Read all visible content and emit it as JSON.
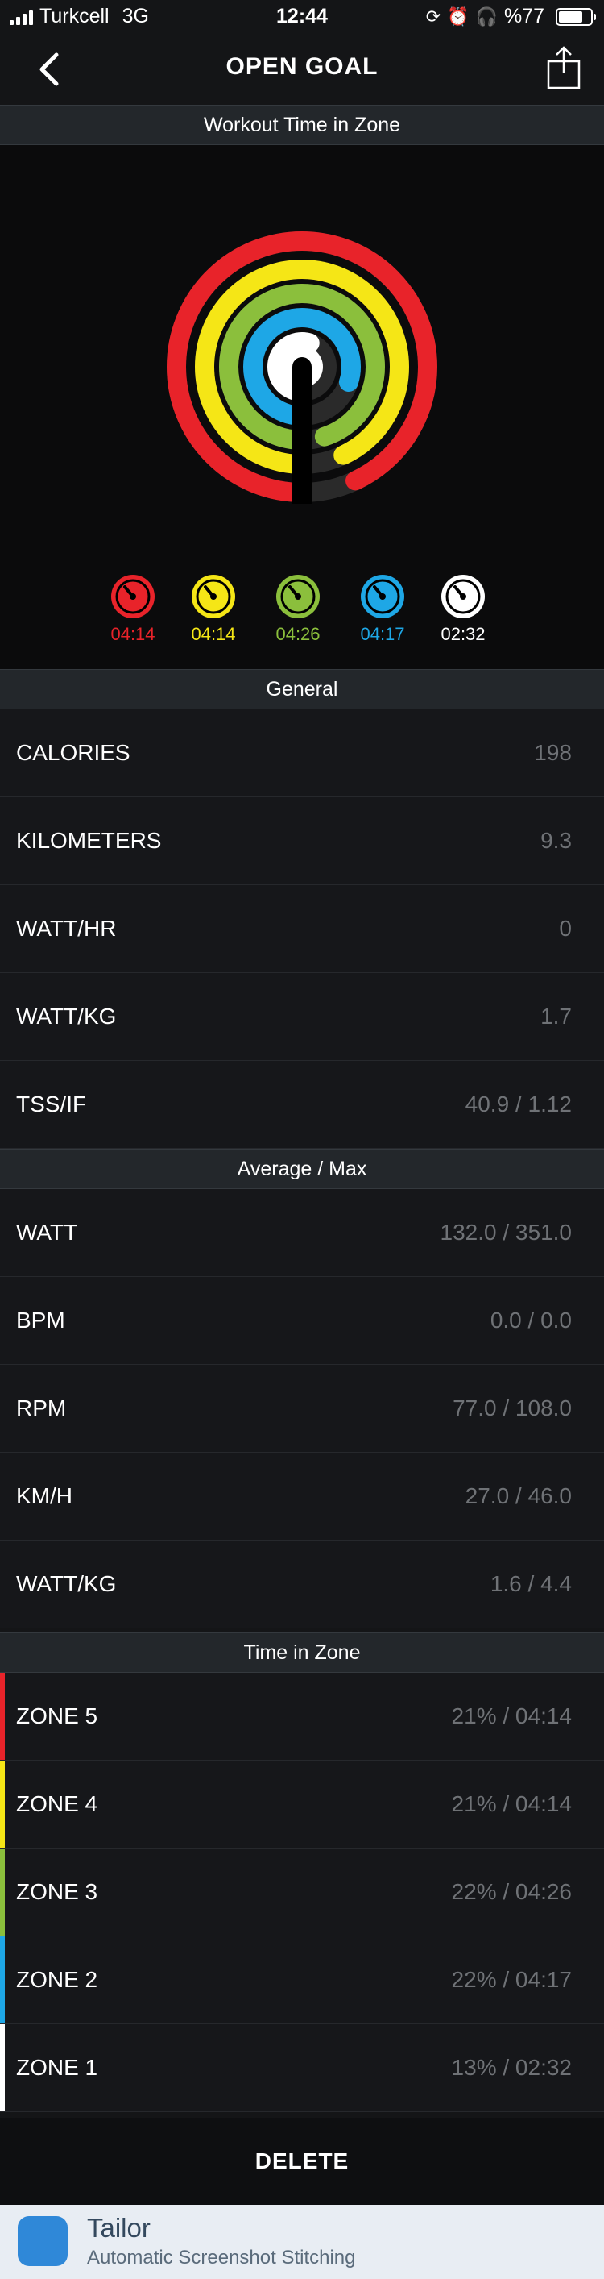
{
  "status_bar": {
    "carrier": "Turkcell",
    "network": "3G",
    "time": "12:44",
    "battery": "%77",
    "battery_level": 0.77,
    "icons": [
      "signal-bars-icon",
      "rotation-lock-icon",
      "alarm-icon",
      "headphones-icon",
      "battery-icon"
    ]
  },
  "nav": {
    "title": "OPEN GOAL",
    "back_icon": "chevron-left-icon",
    "share_icon": "share-icon"
  },
  "workout_section": {
    "header": "Workout Time in Zone"
  },
  "zone_chart": {
    "rings": [
      {
        "zone": "ZONE 5",
        "color": "#e8232a",
        "fraction": 0.93
      },
      {
        "zone": "ZONE 4",
        "color": "#f5e616",
        "fraction": 0.93
      },
      {
        "zone": "ZONE 3",
        "color": "#8bbf3c",
        "fraction": 0.95
      },
      {
        "zone": "ZONE 2",
        "color": "#1ea7e6",
        "fraction": 0.8
      },
      {
        "zone": "ZONE 1",
        "color": "#ffffff",
        "fraction": 0.55
      }
    ],
    "legend": [
      {
        "label": "04:14",
        "color": "#e8232a"
      },
      {
        "label": "04:14",
        "color": "#f5e616"
      },
      {
        "label": "04:26",
        "color": "#8bbf3c"
      },
      {
        "label": "04:17",
        "color": "#1ea7e6"
      },
      {
        "label": "02:32",
        "color": "#ffffff"
      }
    ]
  },
  "general": {
    "header": "General",
    "rows": [
      {
        "label": "CALORIES",
        "value": "198"
      },
      {
        "label": "KILOMETERS",
        "value": "9.3"
      },
      {
        "label": "WATT/HR",
        "value": "0"
      },
      {
        "label": "WATT/KG",
        "value": "1.7"
      },
      {
        "label": "TSS/IF",
        "value": "40.9 / 1.12"
      }
    ]
  },
  "average_max": {
    "header": "Average / Max",
    "rows": [
      {
        "label": "WATT",
        "value": "132.0 / 351.0"
      },
      {
        "label": "BPM",
        "value": "0.0 / 0.0"
      },
      {
        "label": "RPM",
        "value": "77.0 / 108.0"
      },
      {
        "label": "KM/H",
        "value": "27.0 / 46.0"
      },
      {
        "label": "WATT/KG",
        "value": "1.6 / 4.4"
      }
    ]
  },
  "time_in_zone": {
    "header": "Time in Zone",
    "rows": [
      {
        "label": "ZONE 5",
        "value": "21% / 04:14",
        "color": "#e8232a"
      },
      {
        "label": "ZONE 4",
        "value": "21% / 04:14",
        "color": "#f5e616"
      },
      {
        "label": "ZONE 3",
        "value": "22% / 04:26",
        "color": "#8bbf3c"
      },
      {
        "label": "ZONE 2",
        "value": "22% / 04:17",
        "color": "#1ea7e6"
      },
      {
        "label": "ZONE 1",
        "value": "13% / 02:32",
        "color": "#ffffff"
      }
    ]
  },
  "actions": {
    "delete_label": "DELETE"
  },
  "banner": {
    "title": "Tailor",
    "subtitle": "Automatic Screenshot Stitching",
    "icon": "tailor-app-icon"
  }
}
